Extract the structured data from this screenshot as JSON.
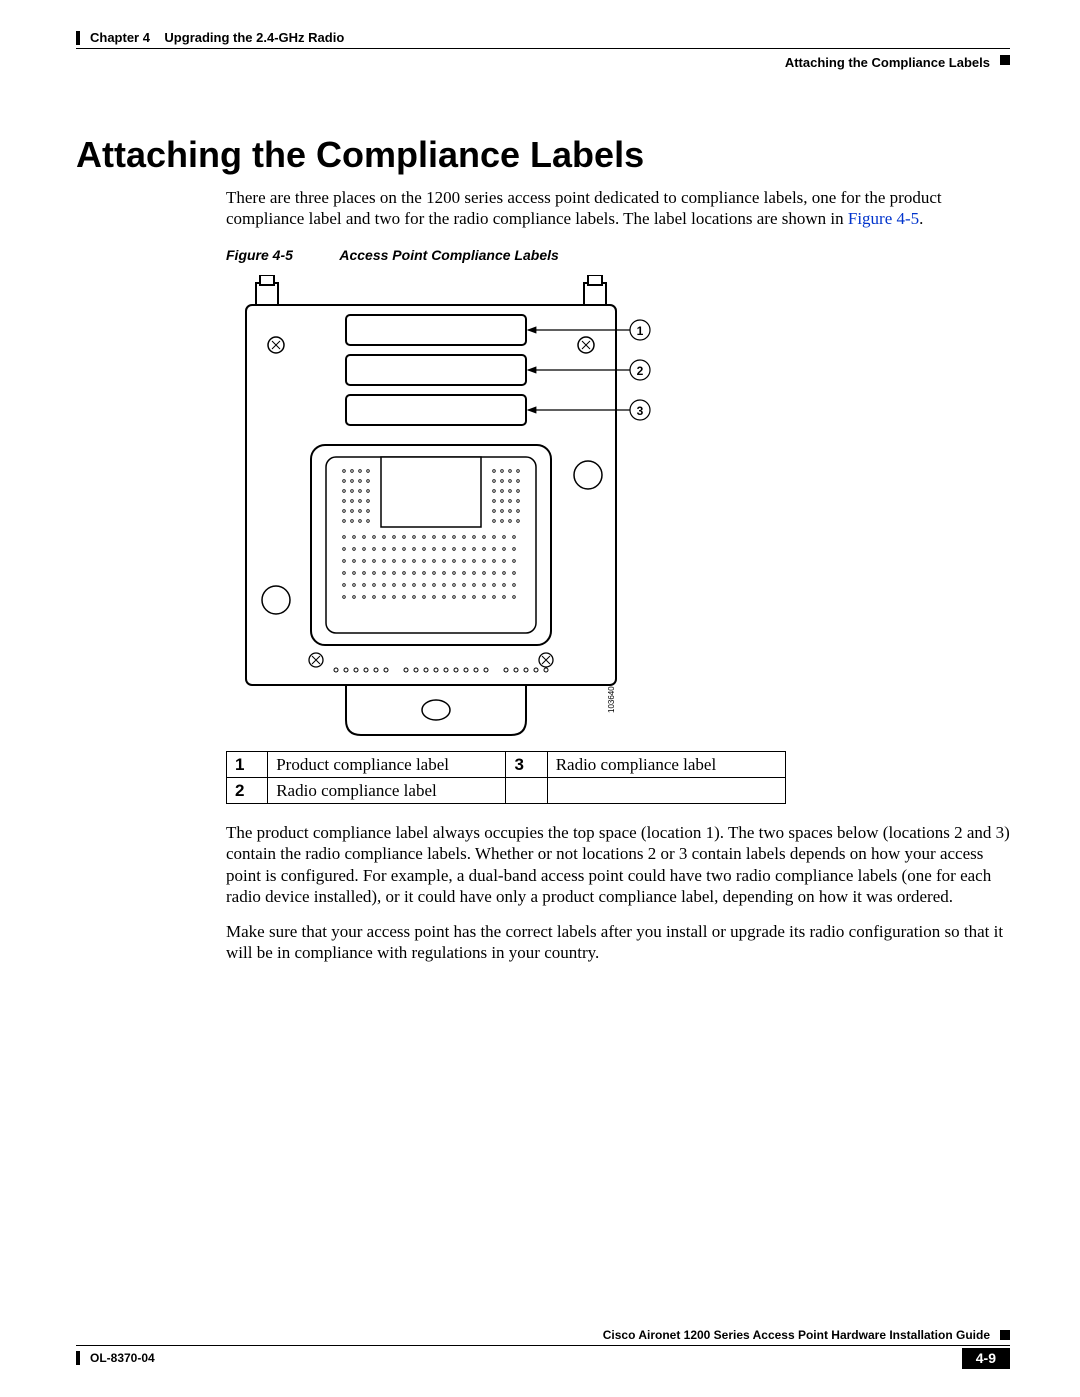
{
  "header": {
    "chapter_label": "Chapter 4",
    "chapter_title": "Upgrading the 2.4-GHz Radio",
    "section_crumb": "Attaching the Compliance Labels"
  },
  "section": {
    "heading": "Attaching the Compliance Labels",
    "para1_a": "There are three places on the 1200 series access point dedicated to compliance labels, one for the product compliance label and two for the radio compliance labels. The label locations are shown in ",
    "para1_link": "Figure 4-5",
    "para1_b": ".",
    "para2": "The product compliance label always occupies the top space (location 1). The two spaces below (locations 2 and 3) contain the radio compliance labels. Whether or not locations 2 or 3 contain labels depends on how your access point is configured. For example, a dual-band access point could have two radio compliance labels (one for each radio device installed), or it could have only a product compliance label, depending on how it was ordered.",
    "para3": "Make sure that your access point has the correct labels after you install or upgrade its radio configuration so that it will be in compliance with regulations in your country."
  },
  "figure": {
    "number": "Figure 4-5",
    "title": "Access Point Compliance Labels",
    "image_ref": "103640",
    "callouts": [
      "1",
      "2",
      "3"
    ]
  },
  "legend": [
    {
      "num": "1",
      "text": "Product compliance label"
    },
    {
      "num": "2",
      "text": "Radio compliance label"
    },
    {
      "num": "3",
      "text": "Radio compliance label"
    }
  ],
  "footer": {
    "book_title": "Cisco Aironet 1200 Series Access Point Hardware Installation Guide",
    "doc_id": "OL-8370-04",
    "page_num": "4-9"
  }
}
